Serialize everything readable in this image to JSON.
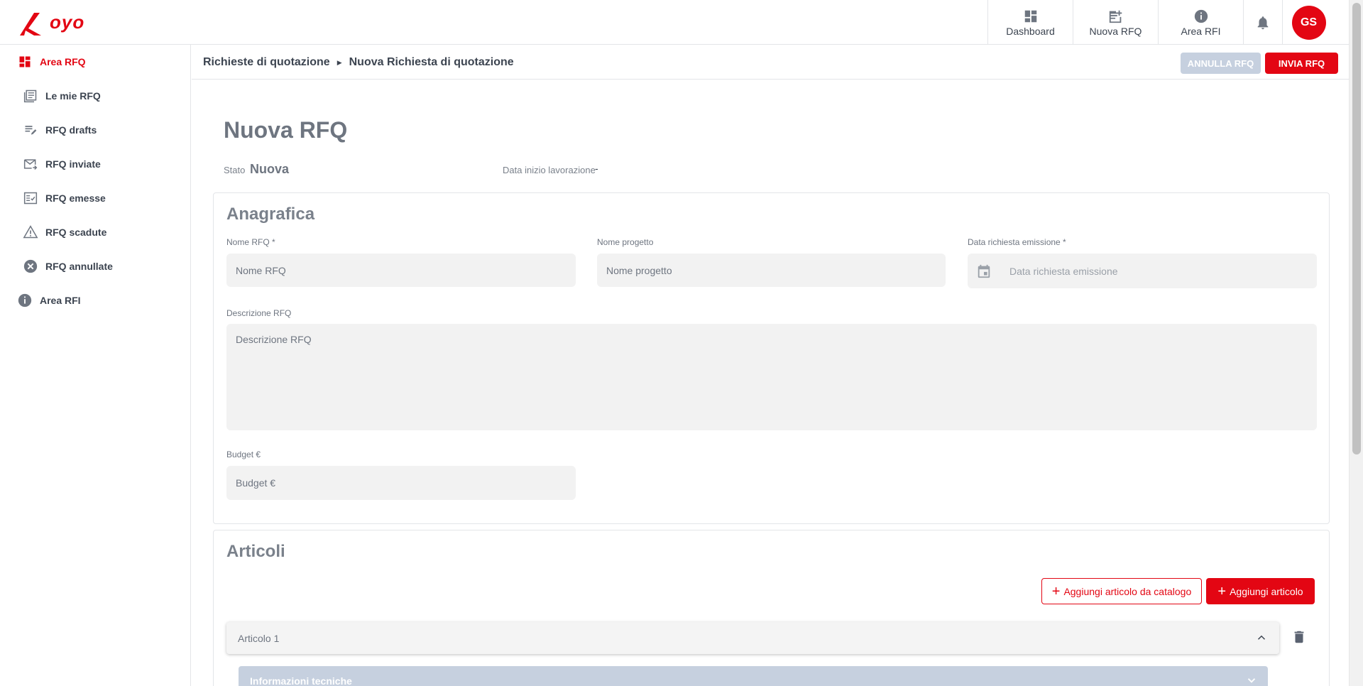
{
  "brand": {
    "logo_text": "oyo",
    "accent": "#e30613"
  },
  "topnav": {
    "dashboard": "Dashboard",
    "nuova_rfq": "Nuova RFQ",
    "area_rfi": "Area RFI",
    "avatar_initials": "GS"
  },
  "sidebar": {
    "items": [
      {
        "label": "Area RFQ",
        "icon": "dashboard-icon",
        "active": true
      },
      {
        "label": "Le mie RFQ",
        "icon": "list-icon"
      },
      {
        "label": "RFQ drafts",
        "icon": "draft-edit-icon"
      },
      {
        "label": "RFQ inviate",
        "icon": "mail-forward-icon"
      },
      {
        "label": "RFQ emesse",
        "icon": "checklist-icon"
      },
      {
        "label": "RFQ scadute",
        "icon": "warning-icon"
      },
      {
        "label": "RFQ annullate",
        "icon": "cancel-icon"
      },
      {
        "label": "Area RFI",
        "icon": "info-icon"
      }
    ]
  },
  "breadcrumb": {
    "parent": "Richieste di quotazione",
    "current": "Nuova Richiesta di quotazione"
  },
  "actions": {
    "annulla": "ANNULLA RFQ",
    "invia": "INVIA RFQ"
  },
  "page": {
    "title": "Nuova RFQ",
    "stato_label": "Stato",
    "stato_value": "Nuova",
    "data_label": "Data inizio lavorazione",
    "data_value": "-"
  },
  "anagrafica": {
    "title": "Anagrafica",
    "nome_rfq": {
      "label": "Nome RFQ *",
      "placeholder": "Nome RFQ",
      "value": ""
    },
    "nome_progetto": {
      "label": "Nome progetto",
      "placeholder": "Nome progetto",
      "value": ""
    },
    "data_emissione": {
      "label": "Data richiesta emissione *",
      "placeholder": "Data richiesta emissione"
    },
    "descrizione": {
      "label": "Descrizione RFQ",
      "placeholder": "Descrizione RFQ",
      "value": ""
    },
    "budget": {
      "label": "Budget €",
      "placeholder": "Budget €",
      "value": ""
    }
  },
  "articoli": {
    "title": "Articoli",
    "add_catalog": "Aggiungi articolo da catalogo",
    "add": "Aggiungi articolo",
    "items": [
      {
        "label": "Articolo 1",
        "sub_section": "Informazioni tecniche"
      }
    ]
  }
}
